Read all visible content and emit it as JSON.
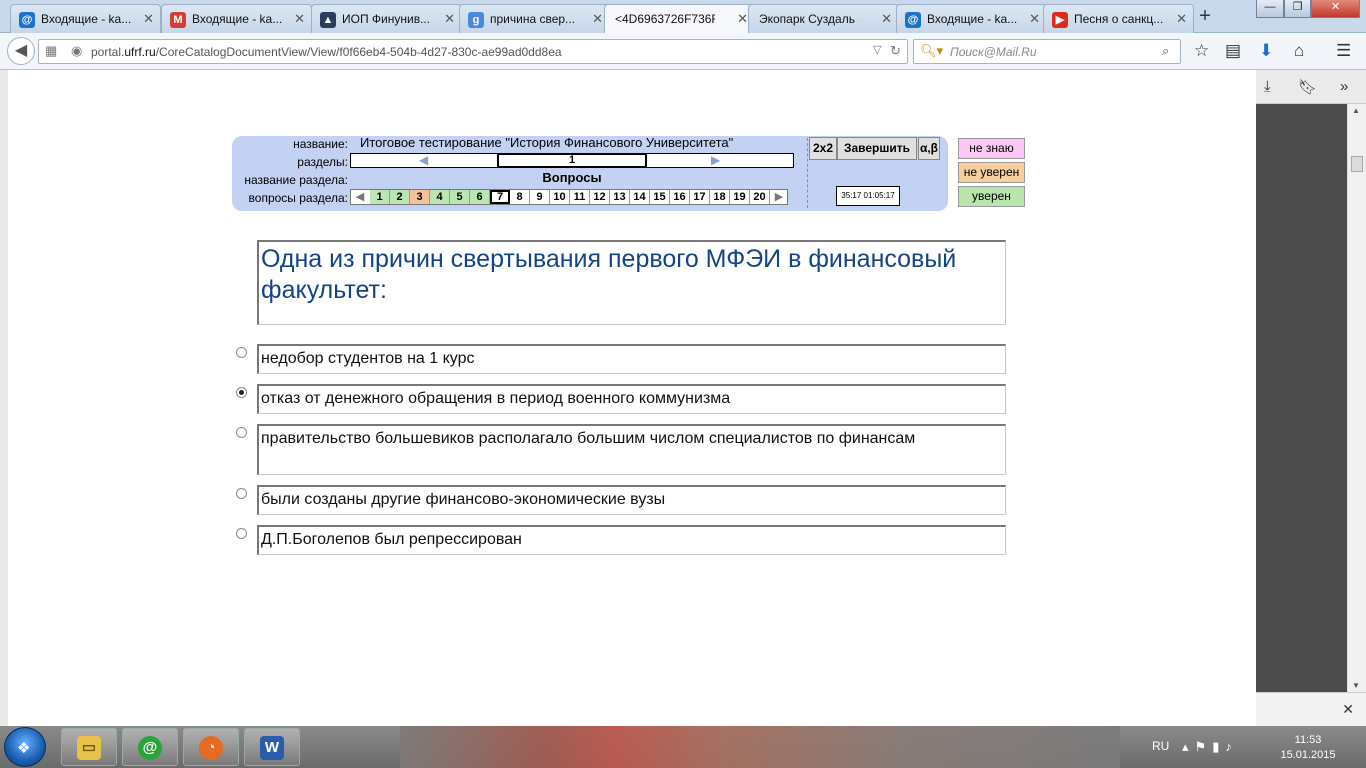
{
  "browser": {
    "tabs": [
      {
        "title": "Входящие - ka...",
        "icon": "mail-ru-icon",
        "color": "#1b74c9"
      },
      {
        "title": "Входящие - ka...",
        "icon": "gmail-icon",
        "color": "#d23f31"
      },
      {
        "title": "ИОП Финунив...",
        "icon": "graduation-cap-icon",
        "color": "#2a3d5e"
      },
      {
        "title": "причина свер...",
        "icon": "google-icon",
        "color": "#4a89dc"
      },
      {
        "title": "<4D6963726F736F...",
        "icon": "",
        "color": "#ffffff"
      },
      {
        "title": "Экопарк Суздаль -...",
        "icon": "",
        "color": "#ffffff"
      },
      {
        "title": "Входящие - ka...",
        "icon": "mail-ru-icon",
        "color": "#1b74c9"
      },
      {
        "title": "Песня о санкц...",
        "icon": "youtube-icon",
        "color": "#e02a20"
      }
    ],
    "url_prefix": "portal.",
    "url_domain": "ufrf.ru",
    "url_path": "/CoreCatalogDocumentView/View/f0f66eb4-504b-4d27-830c-ae99ad0dd8ea",
    "search_placeholder": "Поиск@Mail.Ru"
  },
  "test": {
    "labels": {
      "name": "название:",
      "sections": "разделы:",
      "section_name": "название раздела:",
      "section_questions": "вопросы раздела:"
    },
    "title": "Итоговое тестирование \"История Финансового Университета\"",
    "current_section": "1",
    "section_title": "Вопросы",
    "questions": [
      {
        "n": "1",
        "state": "green"
      },
      {
        "n": "2",
        "state": "green"
      },
      {
        "n": "3",
        "state": "orange"
      },
      {
        "n": "4",
        "state": "green"
      },
      {
        "n": "5",
        "state": "green"
      },
      {
        "n": "6",
        "state": "green"
      },
      {
        "n": "7",
        "state": "current"
      },
      {
        "n": "8",
        "state": "none"
      },
      {
        "n": "9",
        "state": "none"
      },
      {
        "n": "10",
        "state": "none"
      },
      {
        "n": "11",
        "state": "none"
      },
      {
        "n": "12",
        "state": "none"
      },
      {
        "n": "13",
        "state": "none"
      },
      {
        "n": "14",
        "state": "none"
      },
      {
        "n": "15",
        "state": "none"
      },
      {
        "n": "16",
        "state": "none"
      },
      {
        "n": "17",
        "state": "none"
      },
      {
        "n": "18",
        "state": "none"
      },
      {
        "n": "19",
        "state": "none"
      },
      {
        "n": "20",
        "state": "none"
      }
    ],
    "buttons": {
      "grid": "2x2",
      "finish": "Завершить",
      "alphabet": "α,β"
    },
    "timer": "35:17 01:05:17",
    "confidence": [
      {
        "label": "не знаю",
        "color": "#fbc7f5"
      },
      {
        "label": "не уверен",
        "color": "#f7cf9d"
      },
      {
        "label": "уверен",
        "color": "#b7e5ac"
      }
    ]
  },
  "question": {
    "text": " Одна из причин свертывания первого МФЭИ в финансовый факультет:",
    "answers": [
      {
        "text": "недобор студентов на 1 курс",
        "selected": false
      },
      {
        "text": "отказ от денежного обращения в период военного коммунизма",
        "selected": true
      },
      {
        "text": "правительство большевиков располагало большим числом специалистов по финансам",
        "selected": false
      },
      {
        "text": "были созданы другие финансово-экономические вузы",
        "selected": false
      },
      {
        "text": "Д.П.Боголепов был репрессирован",
        "selected": false
      }
    ]
  },
  "taskbar": {
    "language": "RU",
    "time": "11:53",
    "date": "15.01.2015"
  }
}
